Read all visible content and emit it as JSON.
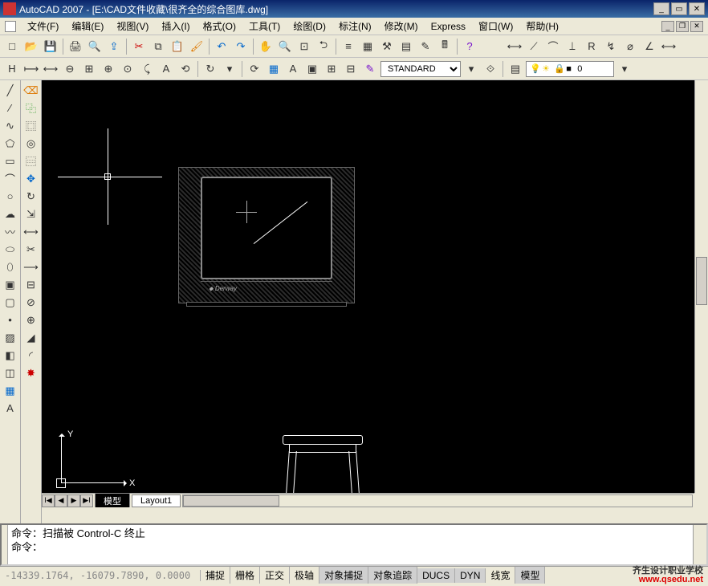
{
  "title": "AutoCAD 2007 - [E:\\CAD文件收藏\\很齐全的综合图库.dwg]",
  "menu": {
    "file": "文件(F)",
    "edit": "编辑(E)",
    "view": "视图(V)",
    "insert": "插入(I)",
    "format": "格式(O)",
    "tools": "工具(T)",
    "draw": "绘图(D)",
    "dimension": "标注(N)",
    "modify": "修改(M)",
    "express": "Express",
    "window": "窗口(W)",
    "help": "帮助(H)"
  },
  "style_select": "STANDARD",
  "layer": {
    "name": "0"
  },
  "tabs": {
    "model": "模型",
    "layout1": "Layout1"
  },
  "ucs": {
    "x": "X",
    "y": "Y"
  },
  "cmd": {
    "line1": "命令：扫描被 Control-C 终止",
    "line2": "命令："
  },
  "status": {
    "coords": "-14339.1764, -16079.7890, 0.0000",
    "snap": "捕捉",
    "grid": "栅格",
    "ortho": "正交",
    "polar": "极轴",
    "osnap": "对象捕捉",
    "otrack": "对象追踪",
    "ducs": "DUCS",
    "dyn": "DYN",
    "lwt": "线宽",
    "model": "模型"
  },
  "watermark": {
    "l1": "齐生设计职业学校",
    "l2": "www.qsedu.net"
  },
  "icons": {
    "new": "□",
    "open": "📂",
    "save": "💾",
    "plot": "🖨",
    "preview": "🔍",
    "cut": "✂",
    "copy": "⧉",
    "paste": "📋",
    "match": "🖌",
    "undo": "↶",
    "redo": "↷",
    "pan": "✋",
    "zoom": "🔍",
    "zoomext": "⤢",
    "props": "≡",
    "dc": "▦",
    "sheet": "▤",
    "tool": "⚒",
    "calc": "🖩",
    "help": "?",
    "h": "H",
    "dim": "⟷",
    "angle": "∠",
    "rad": "R",
    "dia": "⌀",
    "arc": "⌒",
    "line": "╱",
    "cline": "∕",
    "pline": "∿",
    "poly": "⬠",
    "rect": "▭",
    "arc2": "⌒",
    "circle": "○",
    "cloud": "☁",
    "spline": "〰",
    "ellipse": "⬭",
    "block": "▣",
    "point": "•",
    "hatch": "▨",
    "region": "◫",
    "table": "▦",
    "text": "A",
    "erase": "⌫",
    "copy2": "⿻",
    "mirror": "⿴",
    "offset": "◎",
    "array": "⿳",
    "move": "✥",
    "rotate": "↻",
    "scale": "⇲",
    "stretch": "⟷",
    "trim": "✂",
    "extend": "⟶",
    "break": "⊘",
    "join": "⊕",
    "chamfer": "◢",
    "fillet": "◜",
    "explode": "✸",
    "bulb": "💡",
    "sun": "☀",
    "lock": "🔒",
    "layer": "▭"
  }
}
